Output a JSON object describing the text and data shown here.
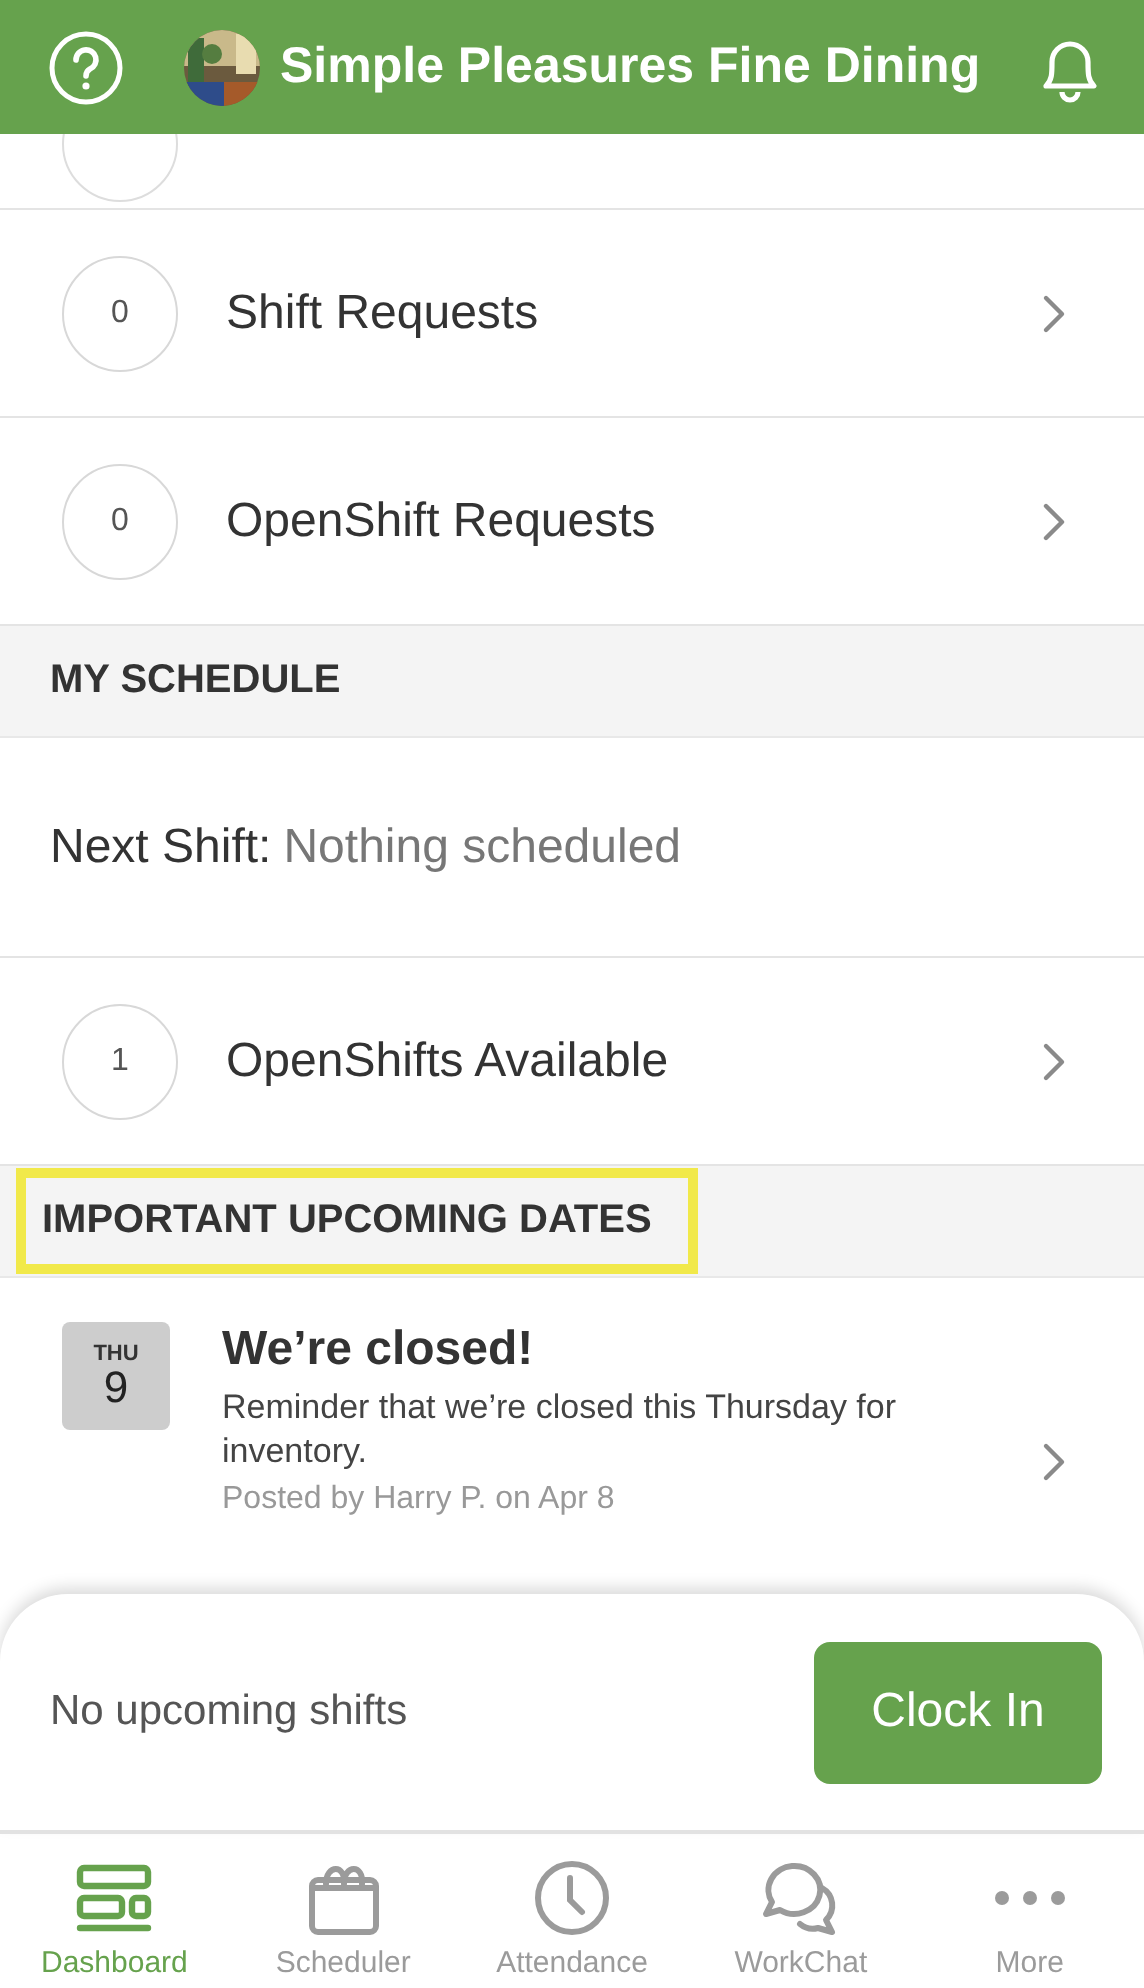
{
  "header": {
    "title": "Simple Pleasures Fine Dining"
  },
  "request_rows": [
    {
      "count": "0",
      "label": "Shift Requests"
    },
    {
      "count": "0",
      "label": "OpenShift Requests"
    }
  ],
  "my_schedule": {
    "heading": "MY SCHEDULE",
    "highlighted": false,
    "next_shift_label": "Next Shift:",
    "next_shift_value": "Nothing scheduled",
    "rows": [
      {
        "count": "1",
        "label": "OpenShifts Available"
      }
    ]
  },
  "upcoming_dates": {
    "heading": "IMPORTANT UPCOMING DATES",
    "highlighted": true,
    "events": [
      {
        "weekday": "THU",
        "day": "9",
        "title": "We’re closed!",
        "body": "Reminder that we’re closed this Thursday for inventory.",
        "meta": "Posted by Harry P. on Apr 8"
      }
    ]
  },
  "clock_panel": {
    "status": "No upcoming shifts",
    "button": "Clock In"
  },
  "tabs": [
    {
      "label": "Dashboard",
      "kind": "dashboard",
      "selected": true
    },
    {
      "label": "Scheduler",
      "kind": "scheduler",
      "selected": false
    },
    {
      "label": "Attendance",
      "kind": "attendance",
      "selected": false
    },
    {
      "label": "WorkChat",
      "kind": "chat",
      "selected": false
    },
    {
      "label": "More",
      "kind": "more",
      "selected": false
    }
  ]
}
